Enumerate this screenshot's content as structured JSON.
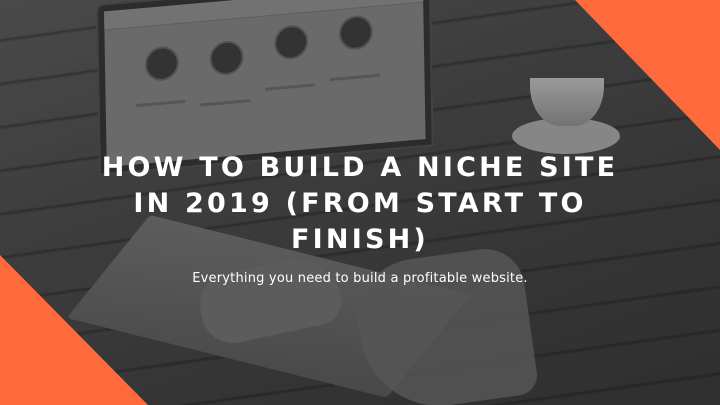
{
  "banner": {
    "headline": "HOW TO BUILD A NICHE SITE IN 2019 (FROM START TO FINISH)",
    "subheadline": "Everything you need to build a profitable website."
  },
  "colors": {
    "accent": "#ff6a3d",
    "text": "#ffffff"
  }
}
